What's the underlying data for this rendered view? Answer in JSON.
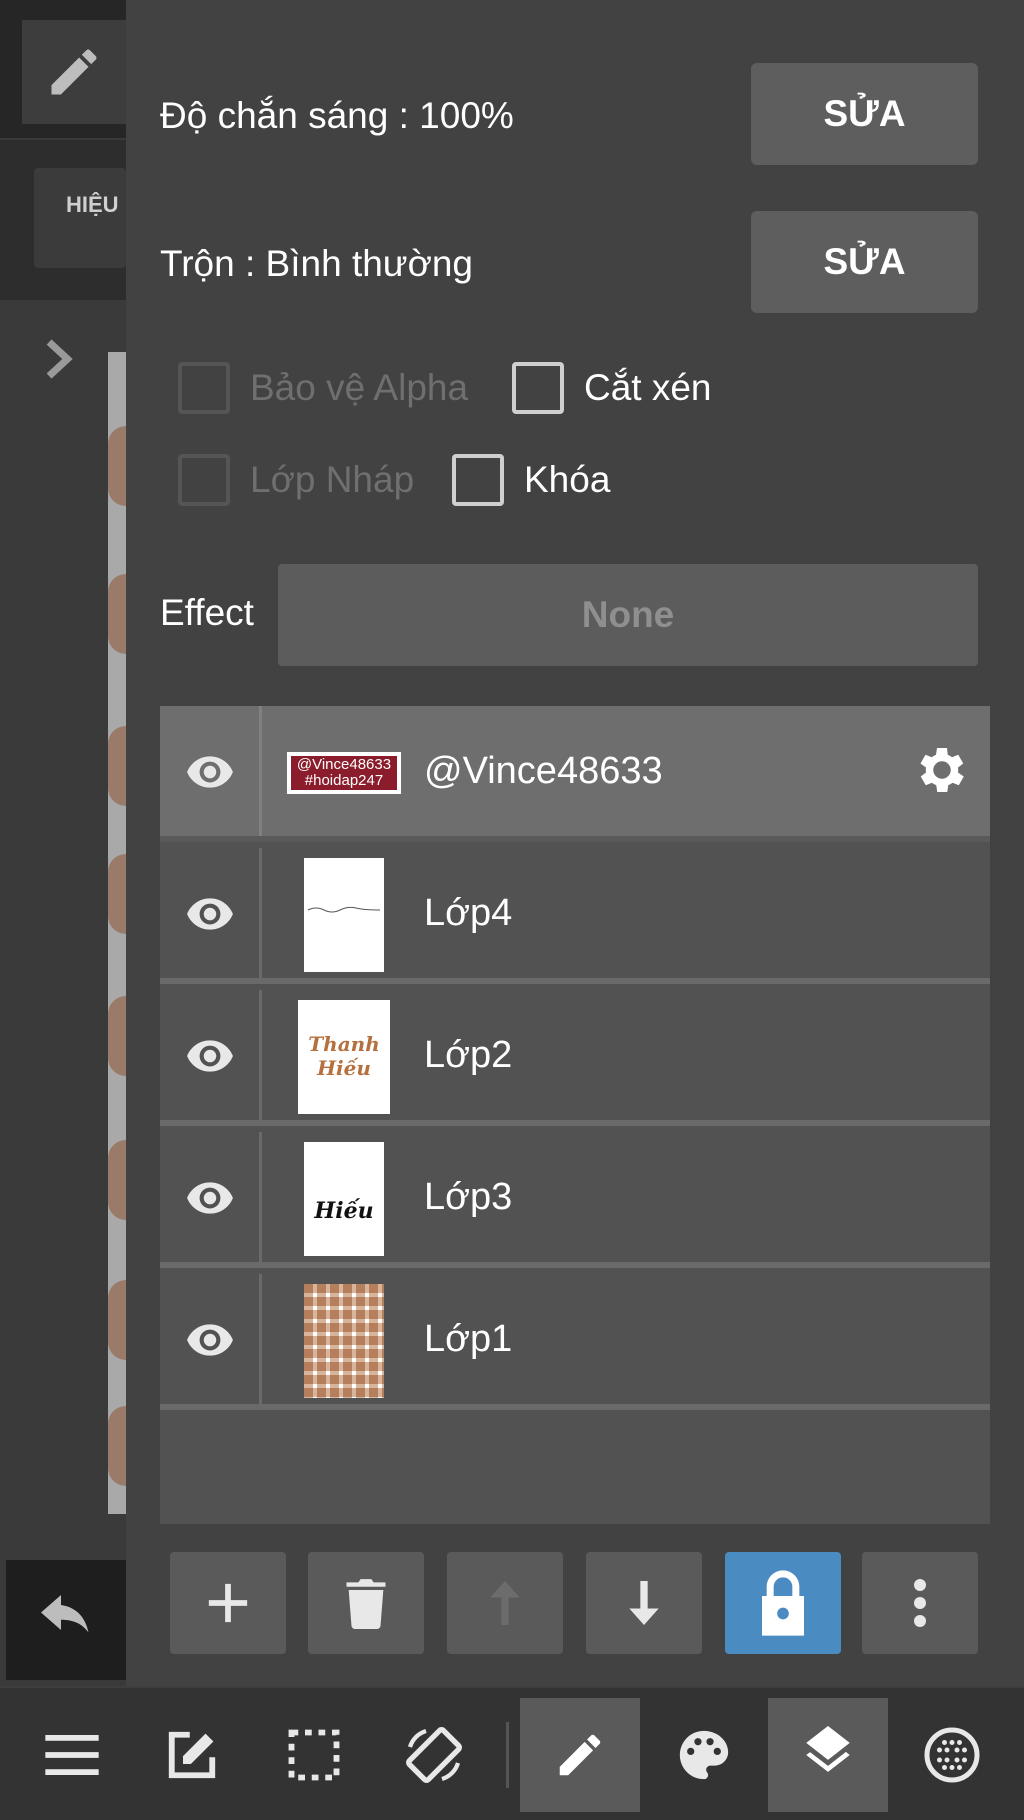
{
  "left_strip": {
    "effect_tab_label": "HIỆU"
  },
  "properties": {
    "opacity_label": "Độ chắn sáng : 100%",
    "opacity_edit": "SỬA",
    "blend_label": "Trộn : Bình thường",
    "blend_edit": "SỬA",
    "checkboxes": {
      "protect_alpha": "Bảo vệ Alpha",
      "clipping": "Cắt xén",
      "draft_layer": "Lớp Nháp",
      "lock": "Khóa"
    },
    "effect_label": "Effect",
    "effect_value": "None"
  },
  "layers": [
    {
      "name": "@Vince48633",
      "selected": true,
      "thumb_text_1": "@Vince48633",
      "thumb_text_2": "#hoidap247"
    },
    {
      "name": "Lớp4",
      "selected": false
    },
    {
      "name": "Lớp2",
      "selected": false,
      "thumb_text_1": "Thanh",
      "thumb_text_2": "Hiếu"
    },
    {
      "name": "Lớp3",
      "selected": false,
      "thumb_text_1": "Hiếu"
    },
    {
      "name": "Lớp1",
      "selected": false
    }
  ],
  "layer_toolbar": {
    "buttons": [
      "add-icon",
      "trash-icon",
      "arrow-up-icon",
      "arrow-down-icon",
      "lock-icon",
      "more-vertical-icon"
    ],
    "active_color": "#4a8bc2"
  },
  "bottom_toolbar": {
    "buttons": [
      "menu-icon",
      "edit-square-icon",
      "selection-icon",
      "rotate-screen-icon",
      "pencil-icon",
      "palette-icon",
      "layers-icon",
      "grid-circle-icon"
    ],
    "active": [
      "pencil-icon",
      "layers-icon"
    ]
  }
}
